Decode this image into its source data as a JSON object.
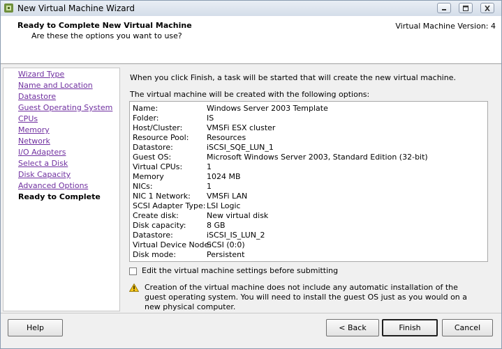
{
  "window": {
    "title": "New Virtual Machine Wizard"
  },
  "header": {
    "title": "Ready to Complete New Virtual Machine",
    "subtitle": "Are these the options you want to use?",
    "version": "Virtual Machine Version: 4"
  },
  "nav": {
    "items": [
      {
        "label": "Wizard Type"
      },
      {
        "label": "Name and Location"
      },
      {
        "label": "Datastore"
      },
      {
        "label": "Guest Operating System"
      },
      {
        "label": "CPUs"
      },
      {
        "label": "Memory"
      },
      {
        "label": "Network"
      },
      {
        "label": "I/O Adapters"
      },
      {
        "label": "Select a Disk"
      },
      {
        "label": "Disk Capacity"
      },
      {
        "label": "Advanced Options"
      },
      {
        "label": "Ready to Complete"
      }
    ],
    "current": "Ready to Complete"
  },
  "content": {
    "intro": "When you click Finish, a task will be started that will create the new virtual machine.",
    "options_label": "The virtual machine will be created with the following options:",
    "summary": [
      {
        "key": "Name:",
        "value": "Windows Server 2003 Template"
      },
      {
        "key": "Folder:",
        "value": "IS"
      },
      {
        "key": "Host/Cluster:",
        "value": "VMSFi ESX cluster"
      },
      {
        "key": "Resource Pool:",
        "value": "Resources"
      },
      {
        "key": "Datastore:",
        "value": "iSCSI_SQE_LUN_1"
      },
      {
        "key": "Guest OS:",
        "value": "Microsoft Windows Server 2003, Standard Edition (32-bit)"
      },
      {
        "key": "Virtual CPUs:",
        "value": "1"
      },
      {
        "key": "Memory",
        "value": "1024 MB"
      },
      {
        "key": "NICs:",
        "value": "1"
      },
      {
        "key": "NIC 1 Network:",
        "value": "VMSFi LAN"
      },
      {
        "key": "SCSI Adapter Type:",
        "value": "LSI Logic"
      },
      {
        "key": "Create disk:",
        "value": "New virtual disk"
      },
      {
        "key": "Disk capacity:",
        "value": "8 GB"
      },
      {
        "key": "Datastore:",
        "value": "iSCSI_IS_LUN_2"
      },
      {
        "key": "Virtual Device Node:",
        "value": "SCSI (0:0)"
      },
      {
        "key": "Disk mode:",
        "value": "Persistent"
      }
    ],
    "edit_checkbox_label": "Edit the virtual machine settings before submitting",
    "edit_checkbox_checked": false,
    "warning": "Creation of the virtual machine does not include any automatic installation of the guest operating system. You will need to install the guest OS just as you would on a new physical computer."
  },
  "buttons": {
    "help": "Help",
    "back": "< Back",
    "finish": "Finish",
    "cancel": "Cancel"
  },
  "icons": {
    "app": "vm-app-icon",
    "warning": "warning-icon",
    "minimize": "minimize-icon",
    "maximize": "maximize-icon",
    "close": "close-icon"
  }
}
